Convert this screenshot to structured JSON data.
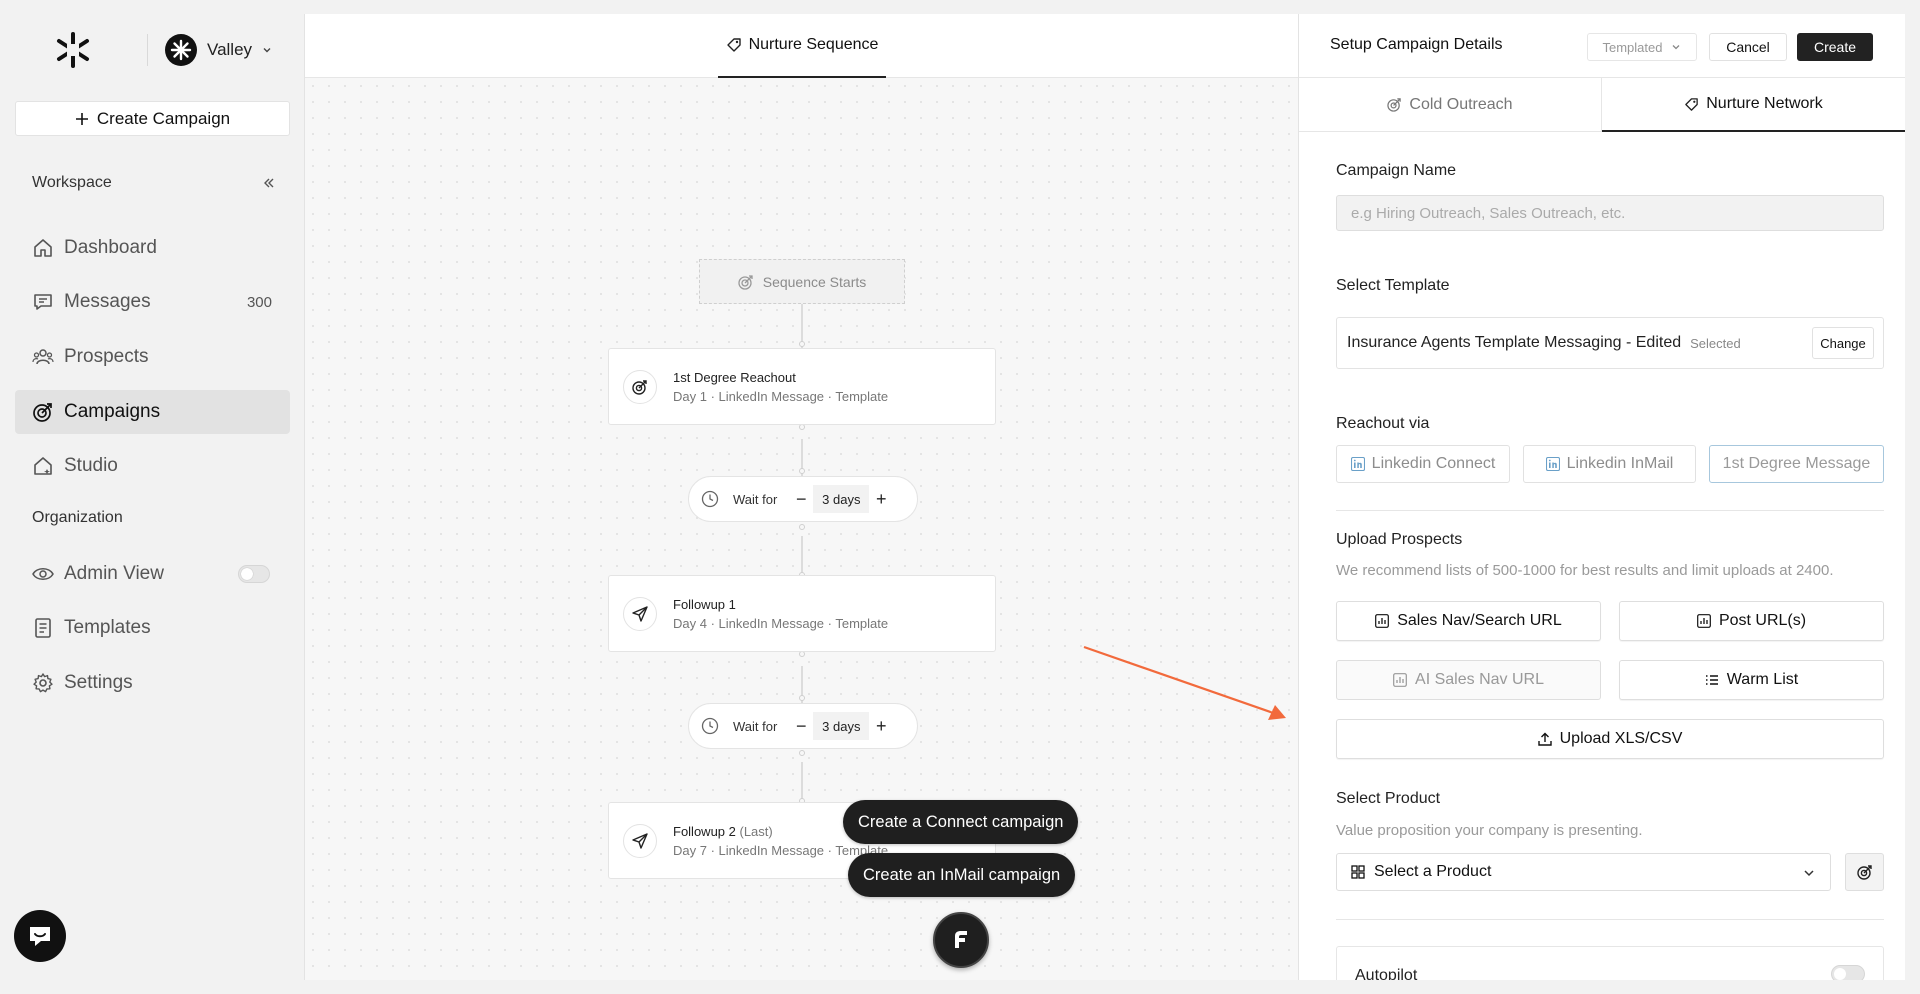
{
  "sidebar": {
    "org_name": "Valley",
    "create_campaign_label": "Create Campaign",
    "workspace_label": "Workspace",
    "organization_label": "Organization",
    "items": [
      {
        "label": "Dashboard",
        "icon": "home-icon"
      },
      {
        "label": "Messages",
        "icon": "message-icon",
        "count": "300"
      },
      {
        "label": "Prospects",
        "icon": "users-icon"
      },
      {
        "label": "Campaigns",
        "icon": "target-icon",
        "active": true
      },
      {
        "label": "Studio",
        "icon": "studio-icon"
      }
    ],
    "org_items": [
      {
        "label": "Admin View",
        "icon": "eye-icon",
        "toggle": false
      },
      {
        "label": "Templates",
        "icon": "document-icon"
      },
      {
        "label": "Settings",
        "icon": "gear-icon"
      }
    ]
  },
  "canvas": {
    "tab_label": "Nurture Sequence",
    "sequence_start_label": "Sequence Starts",
    "steps": [
      {
        "title": "1st Degree Reachout",
        "suffix": "",
        "subtitle": "Day 1 · LinkedIn Message · Template",
        "icon": "target-icon"
      },
      {
        "title": "Followup 1",
        "suffix": "",
        "subtitle": "Day 4 · LinkedIn Message · Template",
        "icon": "send-icon"
      },
      {
        "title": "Followup 2",
        "suffix": "(Last)",
        "subtitle": "Day 7 · LinkedIn Message · Template",
        "icon": "send-icon"
      }
    ],
    "waits": [
      {
        "label": "Wait for",
        "value": "3 days"
      },
      {
        "label": "Wait for",
        "value": "3 days"
      }
    ],
    "fab_actions": [
      "Create a Connect campaign",
      "Create an InMail campaign"
    ]
  },
  "panel": {
    "title": "Setup Campaign Details",
    "template_mode": "Templated",
    "cancel_label": "Cancel",
    "create_label": "Create",
    "tabs": [
      {
        "label": "Cold Outreach",
        "active": false
      },
      {
        "label": "Nurture Network",
        "active": true
      }
    ],
    "campaign_name": {
      "label": "Campaign Name",
      "placeholder": "e.g Hiring Outreach, Sales Outreach, etc.",
      "value": ""
    },
    "template": {
      "label": "Select Template",
      "name": "Insurance Agents Template Messaging - Edited",
      "badge": "Selected",
      "change_label": "Change"
    },
    "reachout": {
      "label": "Reachout via",
      "options": [
        "Linkedin Connect",
        "Linkedin InMail",
        "1st Degree Message"
      ],
      "selected": "1st Degree Message"
    },
    "upload": {
      "label": "Upload Prospects",
      "hint": "We recommend lists of 500-1000 for best results and limit uploads at 2400.",
      "buttons": [
        "Sales Nav/Search URL",
        "Post URL(s)",
        "AI Sales Nav URL",
        "Warm List",
        "Upload XLS/CSV"
      ]
    },
    "product": {
      "label": "Select Product",
      "hint": "Value proposition your company is presenting.",
      "placeholder": "Select a Product"
    },
    "autopilot": {
      "label": "Autopilot",
      "enabled": false
    }
  },
  "colors": {
    "accent": "#222222",
    "annotation_arrow": "#f26a3c",
    "selected_border": "#a7c7dd"
  }
}
